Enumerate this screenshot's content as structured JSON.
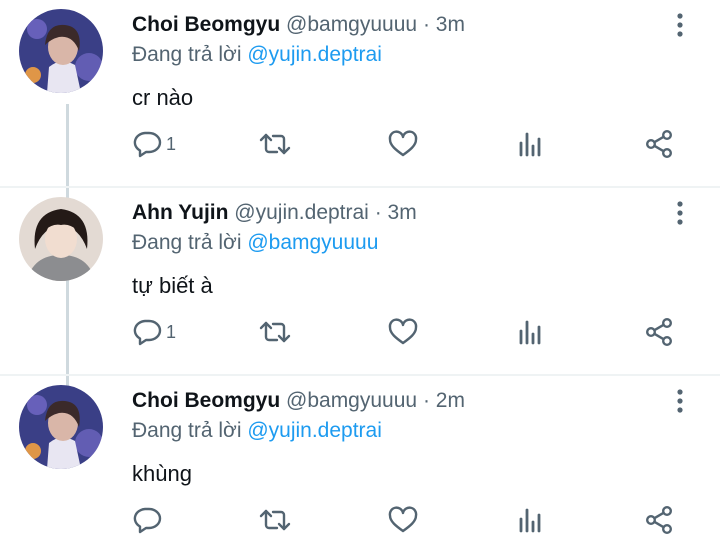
{
  "tweets": [
    {
      "name": "Choi Beomgyu",
      "handle": "@bamgyuuuu",
      "time": "3m",
      "replying_prefix": "Đang trả lời",
      "replying_to": "@yujin.deptrai",
      "text": "cr nào",
      "reply_count": "1",
      "avatar": "beomgyu-avatar"
    },
    {
      "name": "Ahn Yujin",
      "handle": "@yujin.deptrai",
      "time": "3m",
      "replying_prefix": "Đang trả lời",
      "replying_to": "@bamgyuuuu",
      "text": "tự biết à",
      "reply_count": "1",
      "avatar": "yujin-avatar"
    },
    {
      "name": "Choi Beomgyu",
      "handle": "@bamgyuuuu",
      "time": "2m",
      "replying_prefix": "Đang trả lời",
      "replying_to": "@yujin.deptrai",
      "text": "khùng",
      "reply_count": "",
      "avatar": "beomgyu-avatar"
    }
  ],
  "separator": "·",
  "icons": [
    "reply-icon",
    "retweet-icon",
    "like-icon",
    "stats-icon",
    "share-icon",
    "more-icon"
  ],
  "colors": {
    "icon_gray": "#536471",
    "link_blue": "#1d9bf0",
    "thread_line": "#cfd9de"
  }
}
